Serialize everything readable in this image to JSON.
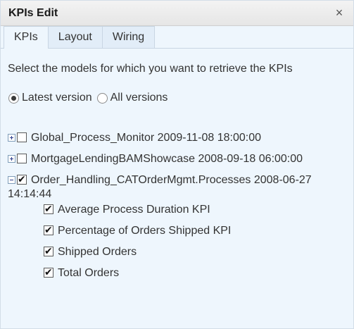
{
  "window": {
    "title": "KPIs Edit",
    "close_symbol": "×"
  },
  "tabs": [
    {
      "label": "KPIs",
      "active": true
    },
    {
      "label": "Layout",
      "active": false
    },
    {
      "label": "Wiring",
      "active": false
    }
  ],
  "instruction": "Select the models for which you want to retrieve the KPIs",
  "version_options": [
    {
      "label": "Latest version",
      "selected": true
    },
    {
      "label": "All versions",
      "selected": false
    }
  ],
  "models": [
    {
      "name": "Global_Process_Monitor 2009-11-08 18:00:00",
      "expanded": false,
      "checked": false
    },
    {
      "name": "MortgageLendingBAMShowcase 2008-09-18 06:00:00",
      "expanded": false,
      "checked": false
    },
    {
      "name": "Order_Handling_CATOrderMgmt.Processes 2008-06-27 14:14:44",
      "expanded": true,
      "checked": true,
      "kpis": [
        {
          "label": "Average Process Duration KPI",
          "checked": true
        },
        {
          "label": "Percentage of Orders Shipped KPI",
          "checked": true
        },
        {
          "label": "Shipped Orders",
          "checked": true
        },
        {
          "label": "Total Orders",
          "checked": true
        }
      ]
    }
  ]
}
